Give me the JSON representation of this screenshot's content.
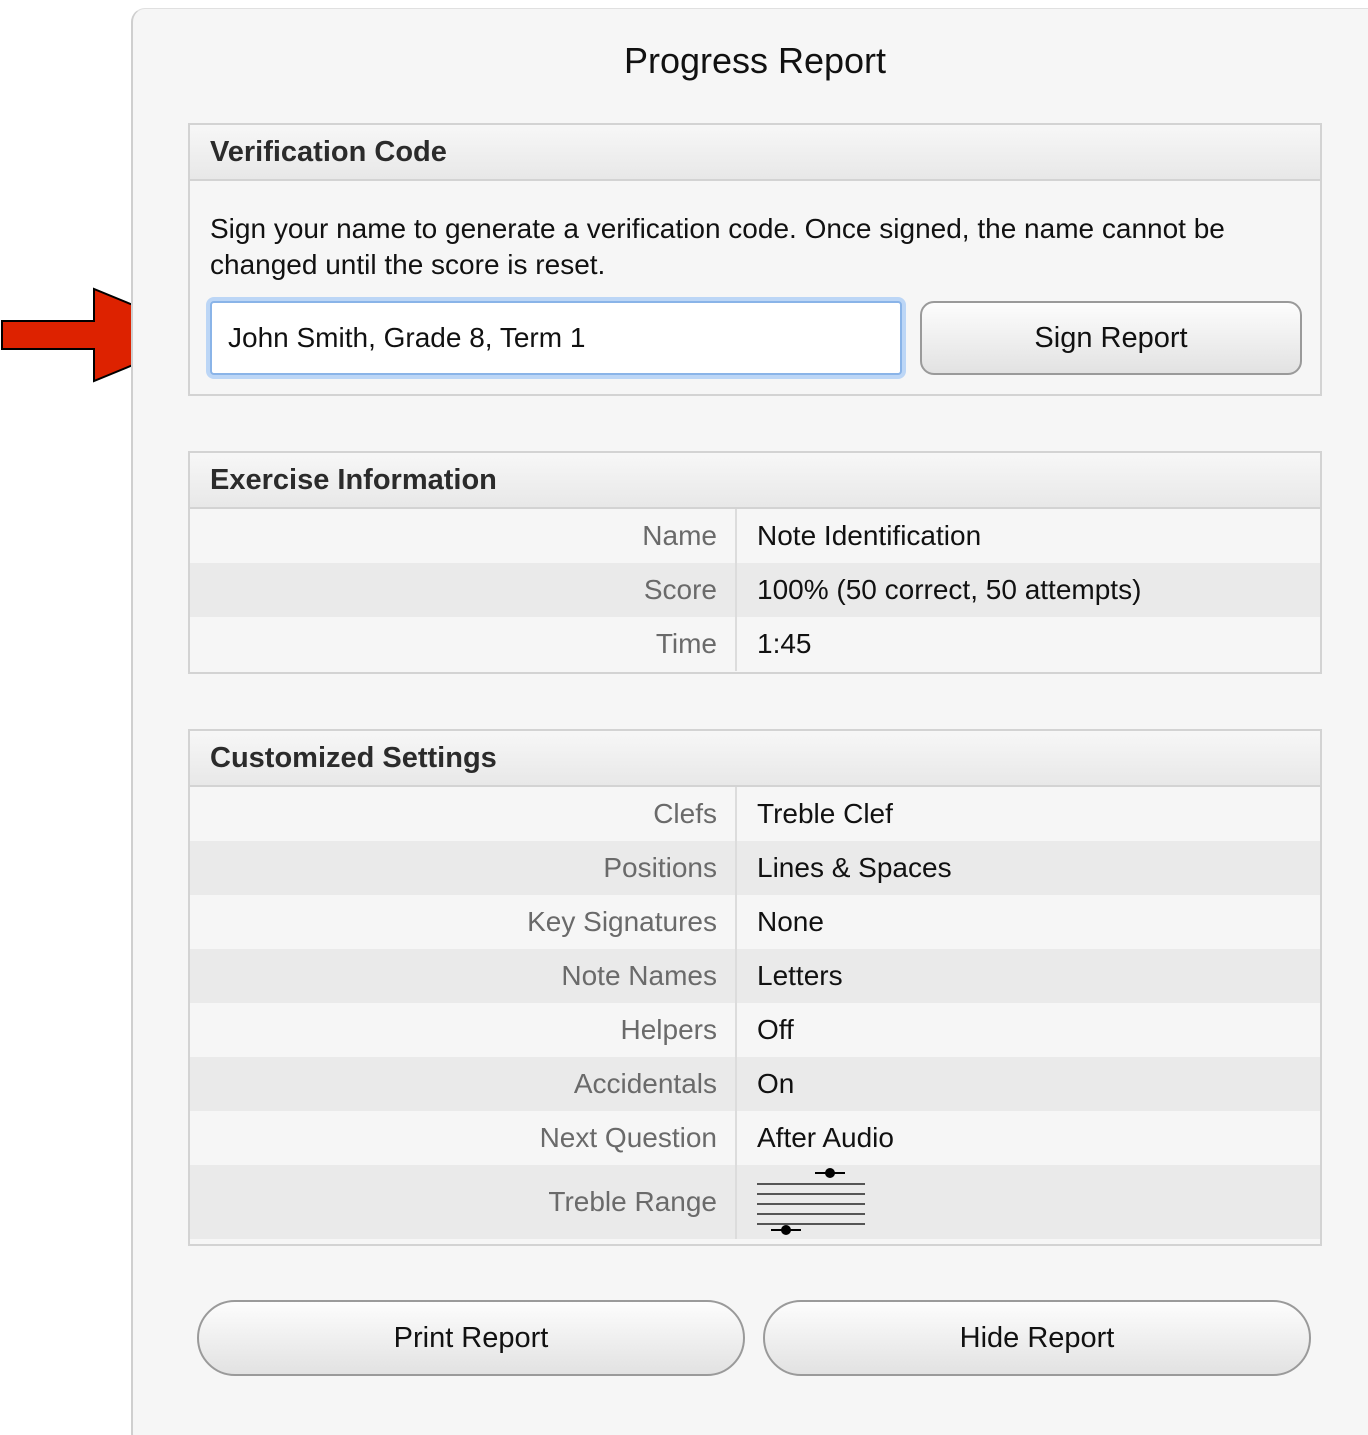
{
  "title": "Progress Report",
  "verification": {
    "header": "Verification Code",
    "instructions": "Sign your name to generate a verification code. Once signed, the name cannot be changed until the score is reset.",
    "name_value": "John Smith, Grade 8, Term 1",
    "sign_label": "Sign Report"
  },
  "exercise": {
    "header": "Exercise Information",
    "rows": [
      {
        "label": "Name",
        "value": "Note Identification"
      },
      {
        "label": "Score",
        "value": "100% (50 correct, 50 attempts)"
      },
      {
        "label": "Time",
        "value": "1:45"
      }
    ]
  },
  "settings": {
    "header": "Customized Settings",
    "rows": [
      {
        "label": "Clefs",
        "value": "Treble Clef"
      },
      {
        "label": "Positions",
        "value": "Lines & Spaces"
      },
      {
        "label": "Key Signatures",
        "value": "None"
      },
      {
        "label": "Note Names",
        "value": "Letters"
      },
      {
        "label": "Helpers",
        "value": "Off"
      },
      {
        "label": "Accidentals",
        "value": "On"
      },
      {
        "label": "Next Question",
        "value": "After Audio"
      },
      {
        "label": "Treble Range",
        "value": ""
      }
    ]
  },
  "buttons": {
    "print_label": "Print Report",
    "hide_label": "Hide Report"
  },
  "colors": {
    "arrow": "#dd2200",
    "focus_ring": "#8ab4e8"
  },
  "icons": {
    "pointer": "arrow-right-icon",
    "range": "staff-range-icon"
  }
}
